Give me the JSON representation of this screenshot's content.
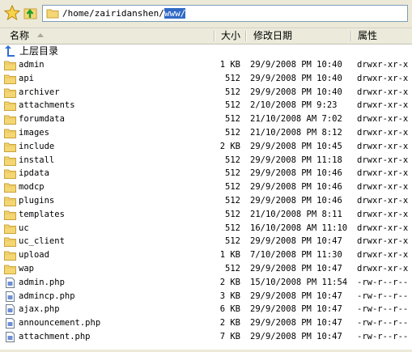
{
  "address": {
    "path_prefix": "/home/zairidanshen/",
    "path_selected": "www/"
  },
  "columns": {
    "name": "名称",
    "size": "大小",
    "modified": "修改日期",
    "attributes": "属性"
  },
  "up_label": "上层目录",
  "files": [
    {
      "name": "admin",
      "size": "1 KB",
      "date": "29/9/2008 PM 10:40",
      "perm": "drwxr-xr-x",
      "type": "folder"
    },
    {
      "name": "api",
      "size": "512",
      "date": "29/9/2008 PM 10:40",
      "perm": "drwxr-xr-x",
      "type": "folder"
    },
    {
      "name": "archiver",
      "size": "512",
      "date": "29/9/2008 PM 10:40",
      "perm": "drwxr-xr-x",
      "type": "folder"
    },
    {
      "name": "attachments",
      "size": "512",
      "date": "2/10/2008 PM 9:23",
      "perm": "drwxr-xr-x",
      "type": "folder"
    },
    {
      "name": "forumdata",
      "size": "512",
      "date": "21/10/2008 AM 7:02",
      "perm": "drwxr-xr-x",
      "type": "folder"
    },
    {
      "name": "images",
      "size": "512",
      "date": "21/10/2008 PM 8:12",
      "perm": "drwxr-xr-x",
      "type": "folder"
    },
    {
      "name": "include",
      "size": "2 KB",
      "date": "29/9/2008 PM 10:45",
      "perm": "drwxr-xr-x",
      "type": "folder"
    },
    {
      "name": "install",
      "size": "512",
      "date": "29/9/2008 PM 11:18",
      "perm": "drwxr-xr-x",
      "type": "folder"
    },
    {
      "name": "ipdata",
      "size": "512",
      "date": "29/9/2008 PM 10:46",
      "perm": "drwxr-xr-x",
      "type": "folder"
    },
    {
      "name": "modcp",
      "size": "512",
      "date": "29/9/2008 PM 10:46",
      "perm": "drwxr-xr-x",
      "type": "folder"
    },
    {
      "name": "plugins",
      "size": "512",
      "date": "29/9/2008 PM 10:46",
      "perm": "drwxr-xr-x",
      "type": "folder"
    },
    {
      "name": "templates",
      "size": "512",
      "date": "21/10/2008 PM 8:11",
      "perm": "drwxr-xr-x",
      "type": "folder"
    },
    {
      "name": "uc",
      "size": "512",
      "date": "16/10/2008 AM 11:10",
      "perm": "drwxr-xr-x",
      "type": "folder"
    },
    {
      "name": "uc_client",
      "size": "512",
      "date": "29/9/2008 PM 10:47",
      "perm": "drwxr-xr-x",
      "type": "folder"
    },
    {
      "name": "upload",
      "size": "1 KB",
      "date": "7/10/2008 PM 11:30",
      "perm": "drwxr-xr-x",
      "type": "folder"
    },
    {
      "name": "wap",
      "size": "512",
      "date": "29/9/2008 PM 10:47",
      "perm": "drwxr-xr-x",
      "type": "folder"
    },
    {
      "name": "admin.php",
      "size": "2 KB",
      "date": "15/10/2008 PM 11:54",
      "perm": "-rw-r--r--",
      "type": "file"
    },
    {
      "name": "admincp.php",
      "size": "3 KB",
      "date": "29/9/2008 PM 10:47",
      "perm": "-rw-r--r--",
      "type": "file"
    },
    {
      "name": "ajax.php",
      "size": "6 KB",
      "date": "29/9/2008 PM 10:47",
      "perm": "-rw-r--r--",
      "type": "file"
    },
    {
      "name": "announcement.php",
      "size": "2 KB",
      "date": "29/9/2008 PM 10:47",
      "perm": "-rw-r--r--",
      "type": "file"
    },
    {
      "name": "attachment.php",
      "size": "7 KB",
      "date": "29/9/2008 PM 10:47",
      "perm": "-rw-r--r--",
      "type": "file"
    }
  ],
  "colors": {
    "folder": "#f4d774",
    "folder_edge": "#c9a23a",
    "selection": "#316ac5",
    "up_arrow": "#2f6fd6"
  },
  "icons": {
    "favorite": "star-icon",
    "up": "up-folder-icon",
    "folder": "folder-icon",
    "file": "php-file-icon"
  }
}
